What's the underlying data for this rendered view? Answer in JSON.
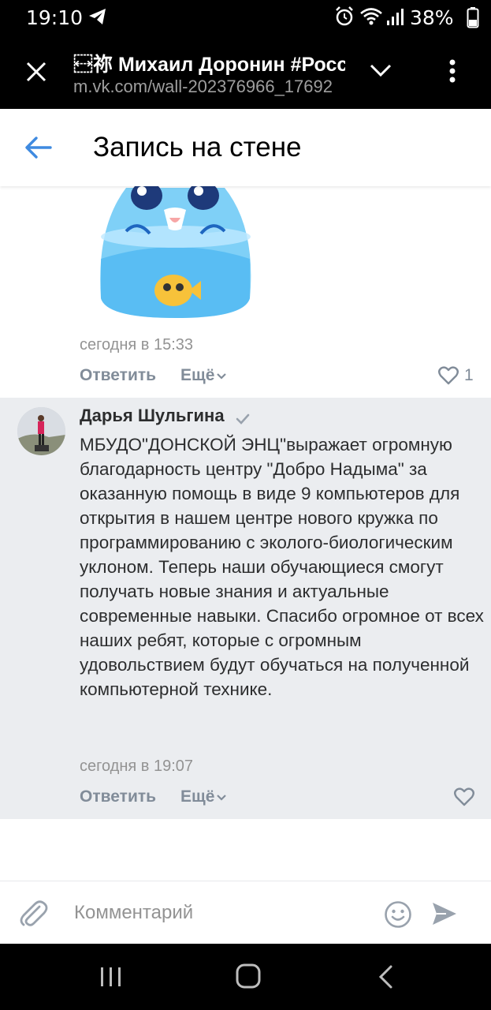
{
  "status_bar": {
    "time": "19:10",
    "battery": "38%",
    "icons": [
      "telegram-icon",
      "alarm-icon",
      "wifi-icon",
      "signal-icon",
      "battery-icon"
    ]
  },
  "browser": {
    "title": "⿾祢 Михаил Доронин #Росс",
    "url": "m.vk.com/wall-202376966_17692"
  },
  "header": {
    "title": "Запись на стене"
  },
  "comments": [
    {
      "has_sticker": true,
      "time": "сегодня в 15:33",
      "reply": "Ответить",
      "more": "Ещё",
      "likes": "1"
    },
    {
      "author": "Дарья Шульгина",
      "verified": true,
      "text": "МБУДО\"ДОНСКОЙ ЭНЦ\"выражает огромную благодарность центру \"Добро Надыма\" за оказанную помощь в виде 9 компьютеров для открытия в нашем центре нового кружка по программированию с эколого-биологическим уклоном. Теперь наши обучающиеся смогут получать новые знания и актуальные современные навыки. Спасибо огромное от всех наших ребят, которые с огромным удовольствием будут обучаться на полученной компьютерной технике.",
      "time": "сегодня в 19:07",
      "reply": "Ответить",
      "more": "Ещё"
    }
  ],
  "comment_input": {
    "placeholder": "Комментарий"
  },
  "colors": {
    "accent": "#3f8ae0",
    "secondary_text": "#818c99",
    "highlight_bg": "#ebedf0",
    "heart_like": "#818c99"
  }
}
